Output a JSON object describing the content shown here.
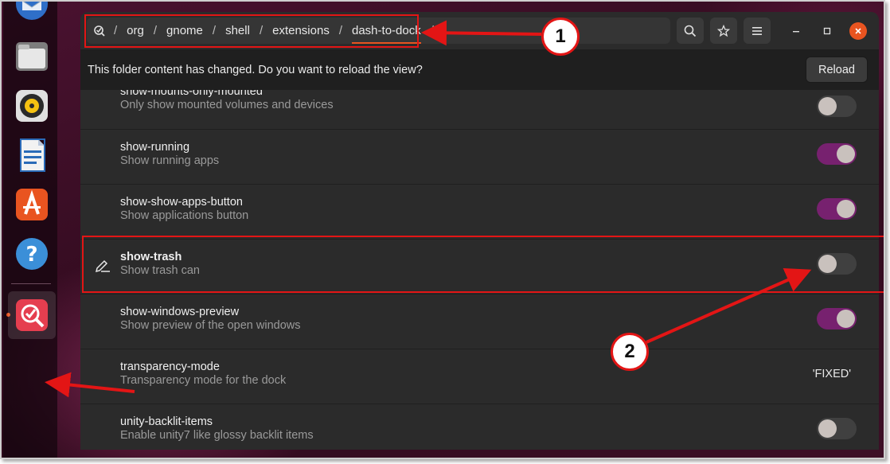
{
  "breadcrumb": {
    "items": [
      "org",
      "gnome",
      "shell",
      "extensions",
      "dash-to-dock"
    ],
    "separator": "/"
  },
  "infobar": {
    "message": "This folder content has changed. Do you want to reload the view?",
    "reload_label": "Reload"
  },
  "rows": [
    {
      "name": "show-mounts-only-mounted",
      "desc": "Only show mounted volumes and devices",
      "type": "toggle",
      "on": false
    },
    {
      "name": "show-running",
      "desc": "Show running apps",
      "type": "toggle",
      "on": true
    },
    {
      "name": "show-show-apps-button",
      "desc": "Show applications button",
      "type": "toggle",
      "on": true
    },
    {
      "name": "show-trash",
      "desc": "Show trash can",
      "type": "toggle",
      "on": false,
      "modified": true
    },
    {
      "name": "show-windows-preview",
      "desc": "Show preview of the open windows",
      "type": "toggle",
      "on": true
    },
    {
      "name": "transparency-mode",
      "desc": "Transparency mode for the dock",
      "type": "value",
      "value": "'FIXED'"
    },
    {
      "name": "unity-backlit-items",
      "desc": "Enable unity7 like glossy backlit items",
      "type": "toggle",
      "on": false
    }
  ],
  "annotations": {
    "callout_1": "1",
    "callout_2": "2"
  },
  "colors": {
    "accent": "#e95420",
    "toggle_on": "#77216f",
    "annotation": "#e31515"
  },
  "icons": {
    "headerbar": [
      "search-icon",
      "star-icon",
      "menu-icon",
      "minimize-icon",
      "maximize-icon",
      "close-icon"
    ],
    "dock": [
      "thunderbird-icon",
      "files-icon",
      "rhythmbox-icon",
      "libreoffice-writer-icon",
      "ubuntu-software-icon",
      "help-icon",
      "dconf-editor-icon"
    ]
  }
}
